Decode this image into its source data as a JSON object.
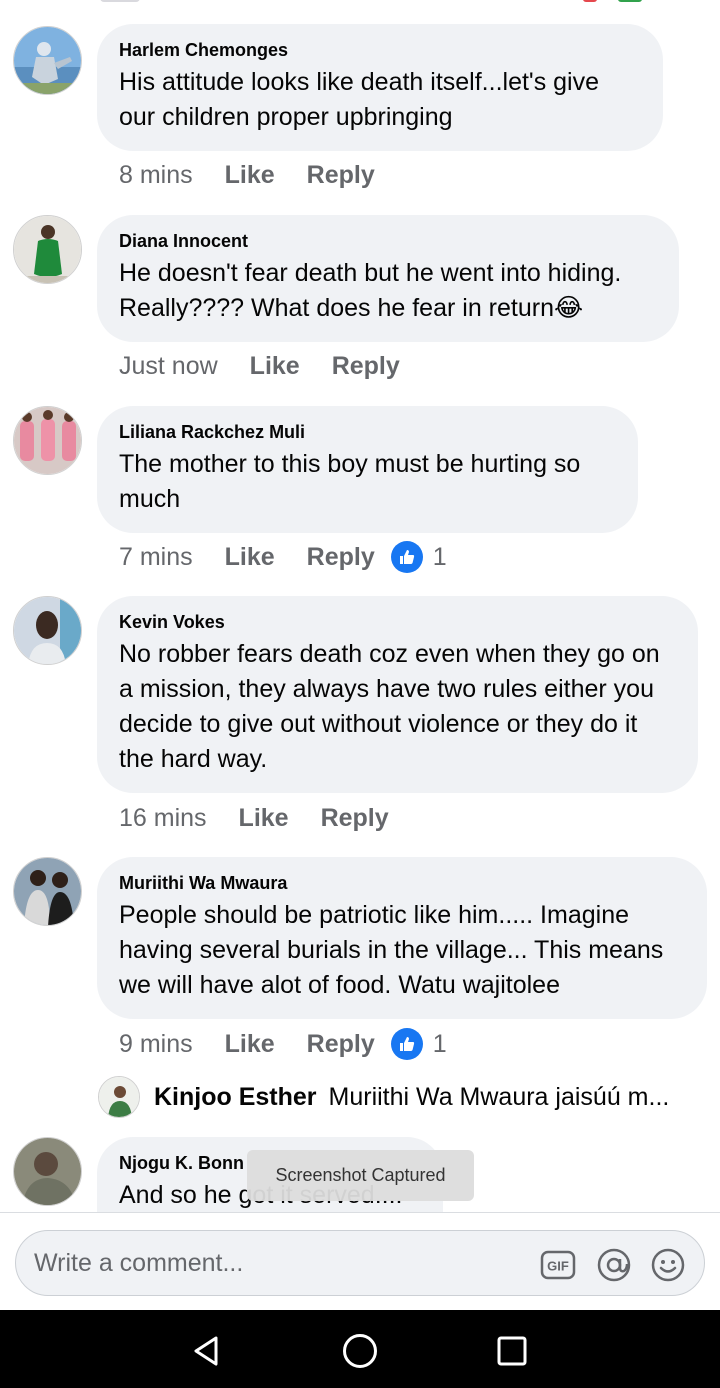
{
  "comments": [
    {
      "author": "Harlem Chemonges",
      "text": "His attitude looks like death itself...let's give our children proper upbringing",
      "time": "8 mins",
      "like": "Like",
      "reply": "Reply"
    },
    {
      "author": "Diana Innocent",
      "text": "He doesn't fear death but he went into hiding. Really???? What does he fear in return",
      "emoji": "😂",
      "time": "Just now",
      "like": "Like",
      "reply": "Reply"
    },
    {
      "author": "Liliana Rackchez Muli",
      "text": "The mother to this boy must be hurting so much",
      "time": "7 mins",
      "like": "Like",
      "reply": "Reply",
      "reactions": "1"
    },
    {
      "author": "Kevin Vokes",
      "text": "No robber fears death coz even when they go on a mission, they always have two rules either you decide to give out without violence or they do it the hard way.",
      "time": "16 mins",
      "like": "Like",
      "reply": "Reply"
    },
    {
      "author": "Muriithi Wa Mwaura",
      "text": "People should be patriotic like him..... Imagine having several burials in the village... This means we will have alot of food. Watu wajitolee",
      "time": "9 mins",
      "like": "Like",
      "reply": "Reply",
      "reactions": "1"
    },
    {
      "author": "Njogu K. Bonn",
      "text": "And so he got it served...."
    }
  ],
  "reply_preview": {
    "author": "Kinjoo Esther",
    "text": "Muriithi Wa Mwaura jaisúú m..."
  },
  "toast": "Screenshot Captured",
  "composer": {
    "placeholder": "Write a comment...",
    "gif_label": "GIF",
    "icons": [
      "gif-icon",
      "mention-icon",
      "emoji-icon"
    ]
  },
  "navigation": {
    "icons": [
      "back-icon",
      "home-icon",
      "recents-icon"
    ]
  },
  "colors": {
    "bubble": "#f0f2f5",
    "meta_text": "#65676b",
    "reaction_blue": "#1877f2",
    "nav_bar": "#000000"
  }
}
